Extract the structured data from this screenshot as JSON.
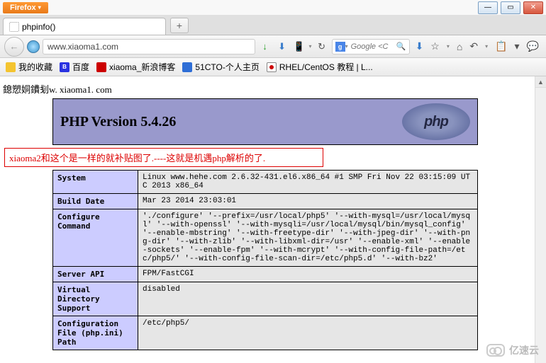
{
  "firefox_label": "Firefox",
  "window": {
    "min_icon": "—",
    "max_icon": "▭",
    "close_icon": "✕"
  },
  "tab": {
    "title": "phpinfo()"
  },
  "newtab_plus": "+",
  "url": "www.xiaoma1.com",
  "nav_icons": {
    "back": "←",
    "down_green": "↓",
    "refresh": "↻",
    "bookmark": "⬇",
    "star": "☆",
    "home": "⌂",
    "clipboard": "📋",
    "undo": "↶",
    "menu": "▾",
    "chat": "💬"
  },
  "search": {
    "provider_letter": "g",
    "placeholder": "Google <C",
    "mag": "🔍"
  },
  "bookmarks": [
    {
      "id": "fav",
      "label": "我的收藏",
      "cls": "bm-yellow"
    },
    {
      "id": "baidu",
      "label": "百度",
      "cls": "bm-baidu",
      "letter": "B"
    },
    {
      "id": "sina",
      "label": "xiaoma_新浪博客",
      "cls": "bm-red"
    },
    {
      "id": "51cto",
      "label": "51CTO-个人主页",
      "cls": "bm-blue"
    },
    {
      "id": "rhel",
      "label": "RHEL/CentOS 教程 | L...",
      "cls": "bm-rhel"
    }
  ],
  "garbled_text": "鎴愬姛鐨刬w. xiaoma1. com",
  "php_version_label": "PHP Version 5.4.26",
  "php_logo_text": "php",
  "annotation_text": "xiaoma2和这个是一样的就补贴图了.----这就是机遇php解析的了.",
  "phpinfo_rows": [
    {
      "k": "System",
      "v": "Linux www.hehe.com 2.6.32-431.el6.x86_64 #1 SMP Fri Nov 22 03:15:09 UTC 2013 x86_64"
    },
    {
      "k": "Build Date",
      "v": "Mar 23 2014 23:03:01"
    },
    {
      "k": "Configure Command",
      "v": "'./configure' '--prefix=/usr/local/php5' '--with-mysql=/usr/local/mysql' '--with-openssl' '--with-mysqli=/usr/local/mysql/bin/mysql_config' '--enable-mbstring' '--with-freetype-dir' '--with-jpeg-dir' '--with-png-dir' '--with-zlib' '--with-libxml-dir=/usr' '--enable-xml' '--enable-sockets' '--enable-fpm' '--with-mcrypt' '--with-config-file-path=/etc/php5/' '--with-config-file-scan-dir=/etc/php5.d' '--with-bz2'"
    },
    {
      "k": "Server API",
      "v": "FPM/FastCGI"
    },
    {
      "k": "Virtual Directory Support",
      "v": "disabled"
    },
    {
      "k": "Configuration File (php.ini) Path",
      "v": "/etc/php5/"
    }
  ],
  "watermark_text": "亿速云"
}
